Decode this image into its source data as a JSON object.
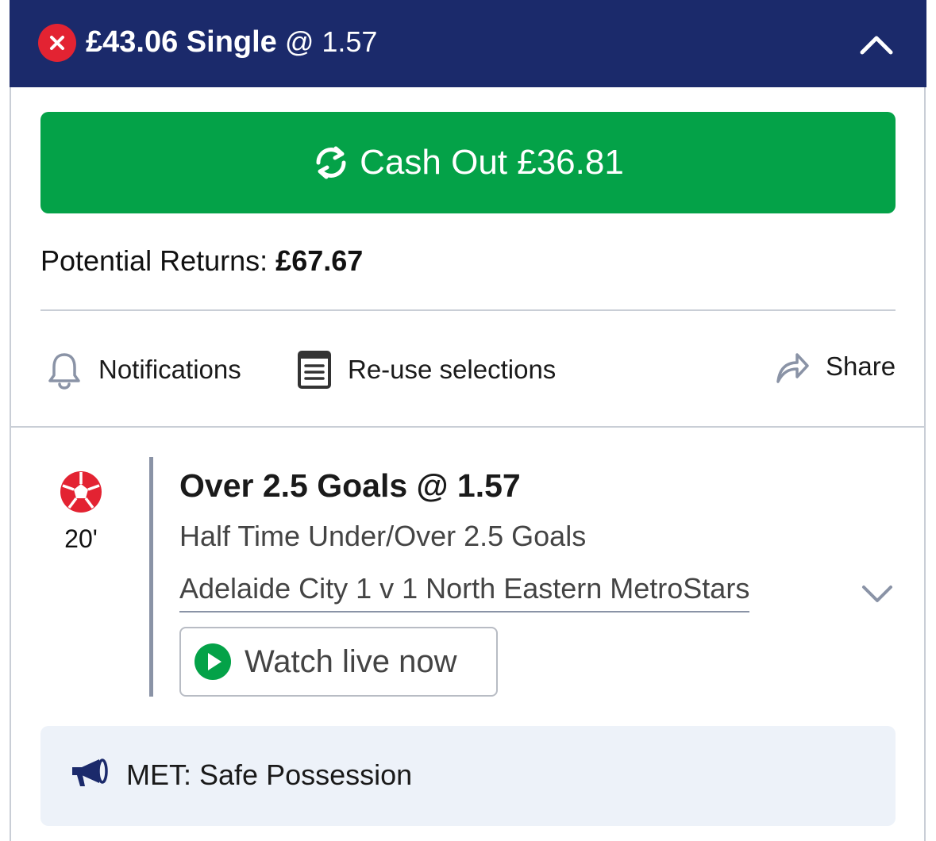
{
  "bet": {
    "stake_label": "£43.06 Single",
    "odds_label": "@ 1.57"
  },
  "cashout": {
    "label": "Cash Out £36.81"
  },
  "returns": {
    "label": "Potential Returns:",
    "value": "£67.67"
  },
  "actions": {
    "notifications": "Notifications",
    "reuse": "Re-use selections",
    "share": "Share"
  },
  "selection": {
    "minute": "20'",
    "title": "Over 2.5 Goals @ 1.57",
    "market": "Half Time Under/Over 2.5 Goals",
    "event": "Adelaide City 1 v 1 North Eastern MetroStars",
    "watch_label": "Watch live now"
  },
  "commentary": {
    "text": "MET: Safe Possession"
  },
  "colors": {
    "header_bg": "#1b2a6b",
    "cashout_green": "#04a248",
    "status_red": "#e32332",
    "banner_bg": "#edf2f9"
  },
  "icons": {
    "close": "close-icon",
    "collapse": "chevron-up-icon",
    "cashout": "refresh-arrows-icon",
    "notifications": "bell-icon",
    "reuse": "document-list-icon",
    "share": "share-arrow-icon",
    "sport": "football-icon",
    "expand": "chevron-down-icon",
    "play": "play-icon",
    "commentary": "megaphone-icon"
  }
}
